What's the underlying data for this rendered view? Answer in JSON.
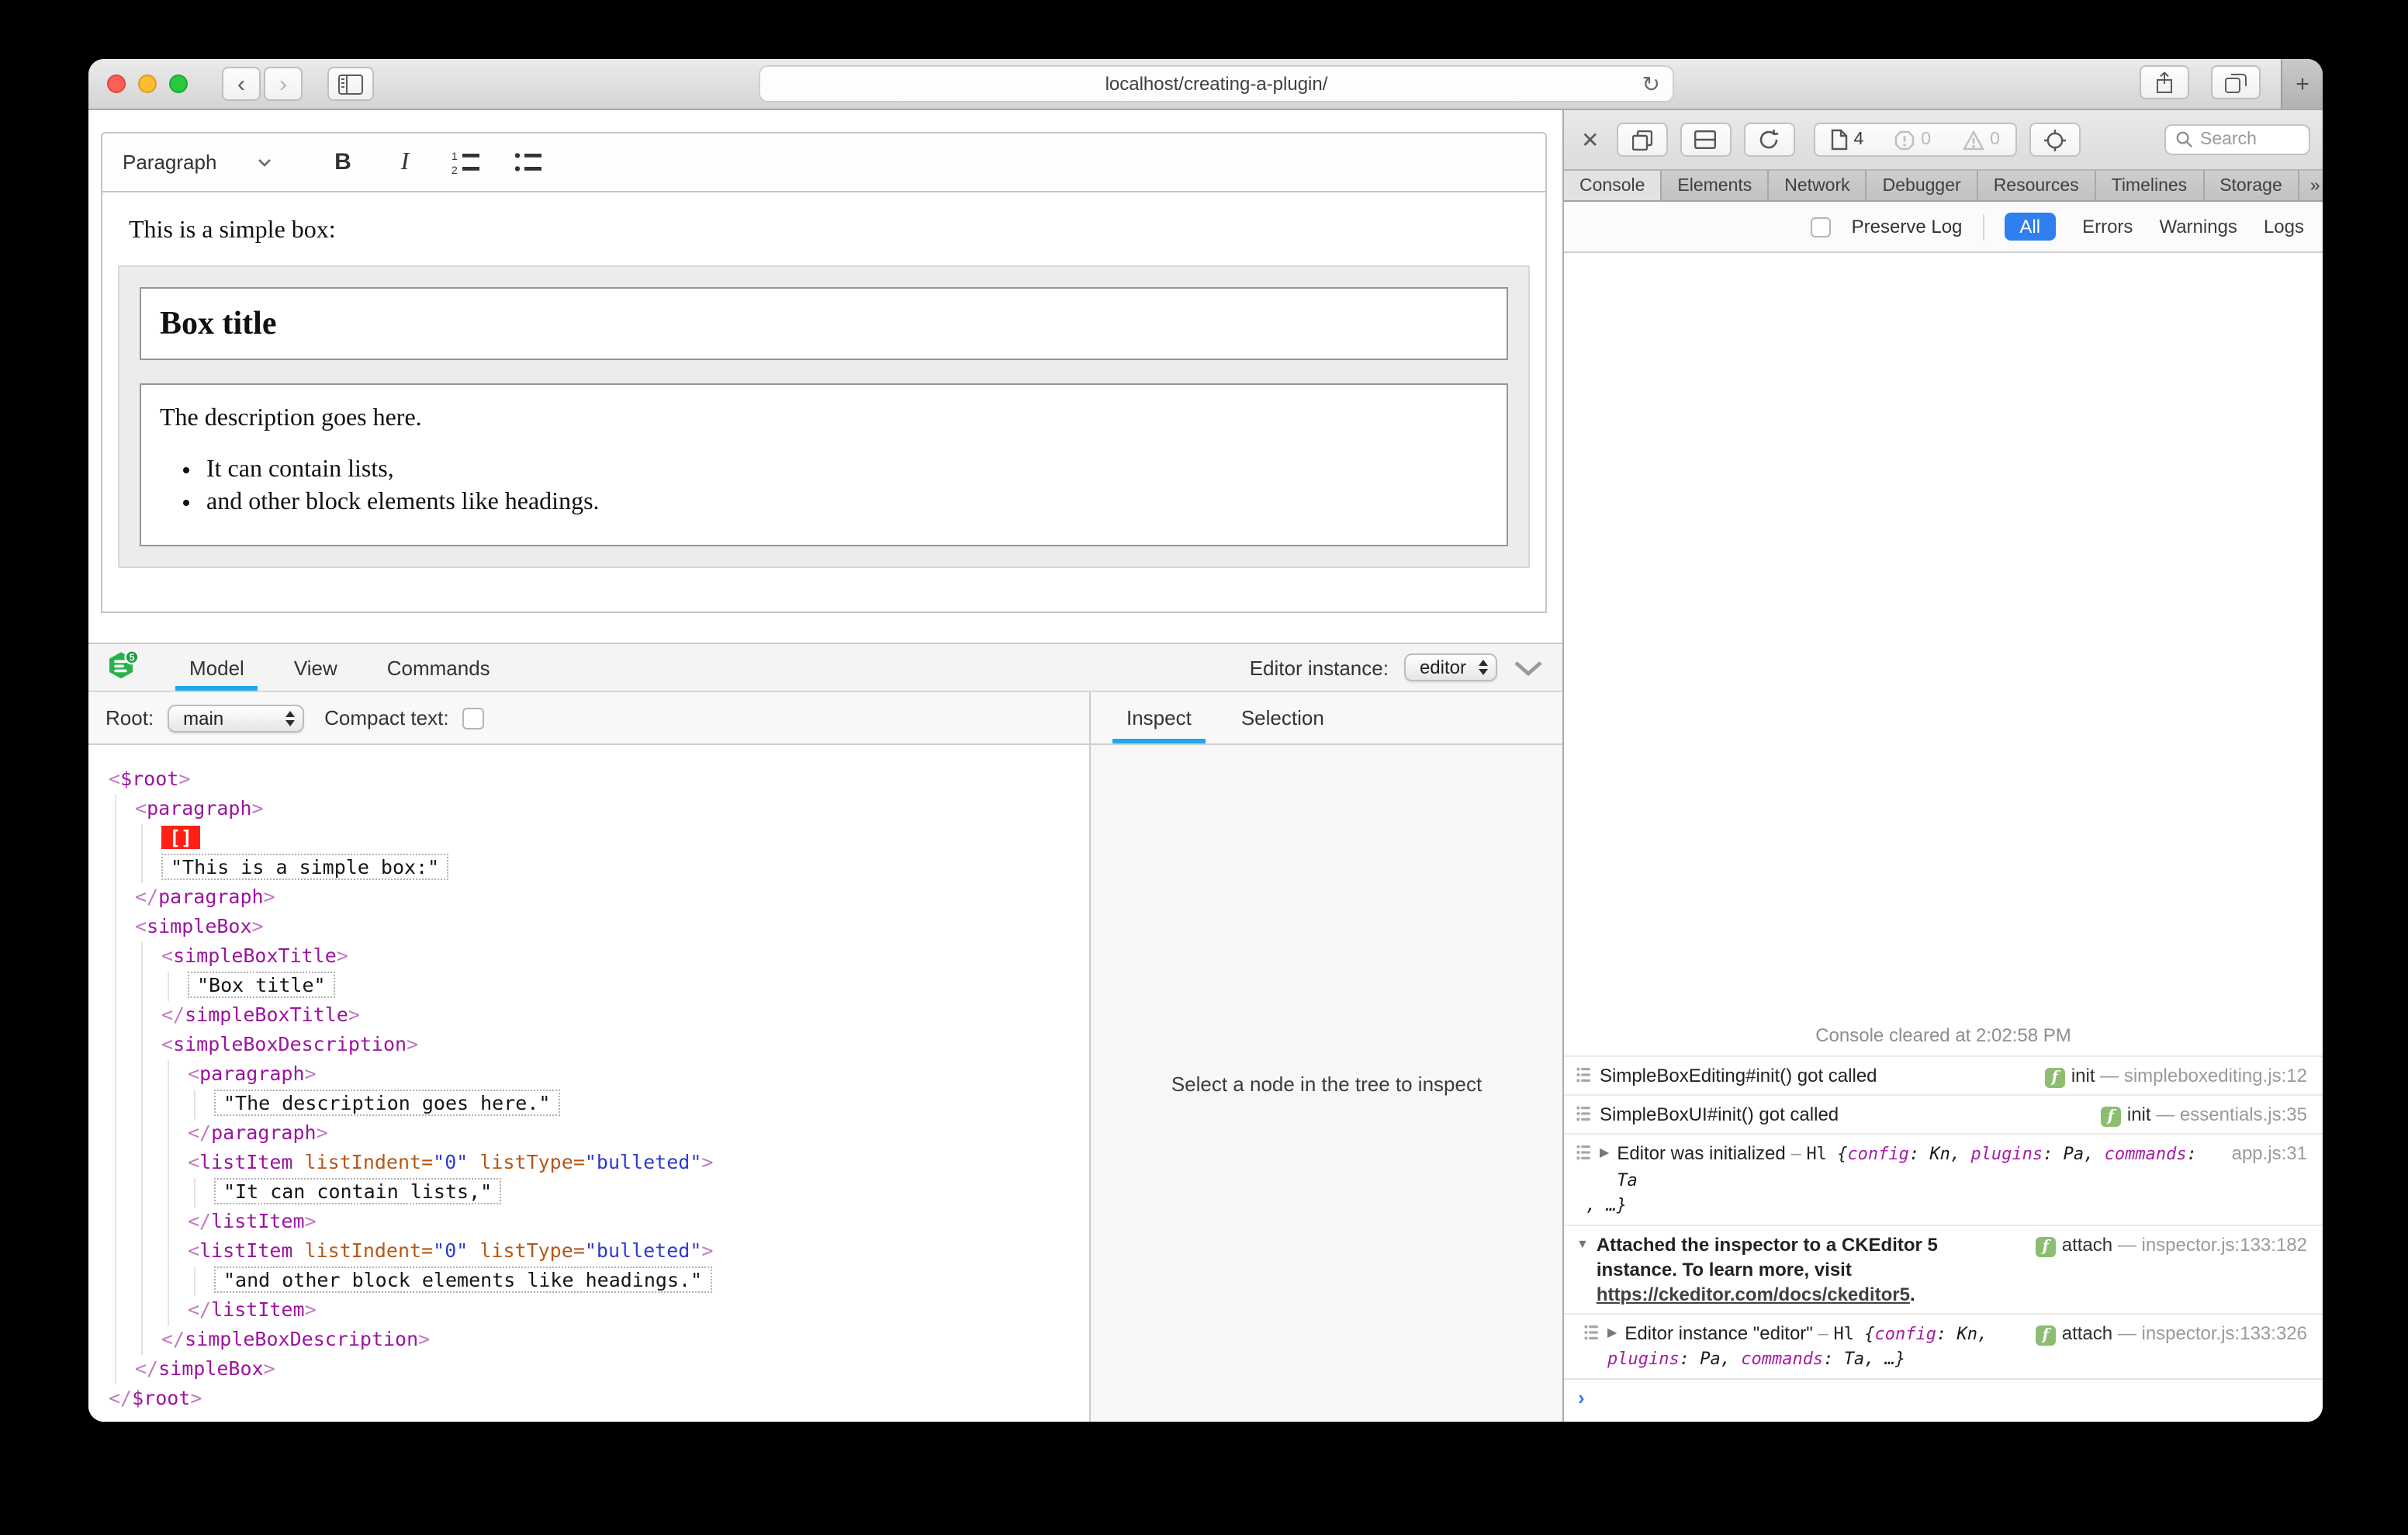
{
  "browser": {
    "url": "localhost/creating-a-plugin/",
    "icons": {
      "back": "‹",
      "forward": "›",
      "reload": "↻",
      "new_tab": "+",
      "close": "✕",
      "more_tabs": "»",
      "settings": "⚙",
      "prompt": "›"
    }
  },
  "editor": {
    "toolbar": {
      "paragraph_label": "Paragraph",
      "bold_label": "B",
      "italic_label": "I"
    },
    "content": {
      "intro": "This is a simple box:",
      "box_title": "Box title",
      "description": "The description goes here.",
      "list": [
        "It can contain lists,",
        "and other block elements like headings."
      ]
    }
  },
  "inspector": {
    "logo_badge": "5",
    "tabs": [
      "Model",
      "View",
      "Commands"
    ],
    "active_tab": "Model",
    "editor_instance_label": "Editor instance:",
    "editor_instance_value": "editor",
    "root_label": "Root:",
    "root_value": "main",
    "compact_text_label": "Compact text:",
    "side_tabs": [
      "Inspect",
      "Selection"
    ],
    "active_side_tab": "Inspect",
    "inspect_placeholder": "Select a node in the tree to inspect",
    "tree": [
      {
        "tag": "$root",
        "children": [
          {
            "tag": "paragraph",
            "children": [
              {
                "selection": "[]"
              },
              {
                "text": "\"This is a simple box:\""
              }
            ]
          },
          {
            "tag": "simpleBox",
            "children": [
              {
                "tag": "simpleBoxTitle",
                "children": [
                  {
                    "text": "\"Box title\""
                  }
                ]
              },
              {
                "tag": "simpleBoxDescription",
                "children": [
                  {
                    "tag": "paragraph",
                    "children": [
                      {
                        "text": "\"The description goes here.\""
                      }
                    ]
                  },
                  {
                    "tag": "listItem",
                    "attrs": [
                      [
                        "listIndent",
                        "\"0\""
                      ],
                      [
                        "listType",
                        "\"bulleted\""
                      ]
                    ],
                    "children": [
                      {
                        "text": "\"It can contain lists,\""
                      }
                    ]
                  },
                  {
                    "tag": "listItem",
                    "attrs": [
                      [
                        "listIndent",
                        "\"0\""
                      ],
                      [
                        "listType",
                        "\"bulleted\""
                      ]
                    ],
                    "children": [
                      {
                        "text": "\"and other block elements like headings.\""
                      }
                    ]
                  }
                ]
              }
            ]
          }
        ]
      }
    ]
  },
  "devtools": {
    "toolbar": {
      "page_count": "4",
      "error_count": "0",
      "warning_count": "0",
      "search_placeholder": "Search"
    },
    "tabs": [
      "Console",
      "Elements",
      "Network",
      "Debugger",
      "Resources",
      "Timelines",
      "Storage"
    ],
    "active_tab": "Console",
    "filter": {
      "preserve_log": "Preserve Log",
      "scopes": [
        "All",
        "Errors",
        "Warnings",
        "Logs"
      ],
      "active_scope": "All"
    },
    "console": {
      "cleared": "Console cleared at 2:02:58 PM",
      "entries": [
        {
          "gutter": true,
          "text": "SimpleBoxEditing#init() got called",
          "right": {
            "badge": "f",
            "fn": "init",
            "loc": "simpleboxediting.js:12"
          }
        },
        {
          "gutter": true,
          "text": "SimpleBoxUI#init() got called",
          "right": {
            "badge": "f",
            "fn": "init",
            "loc": "essentials.js:35"
          }
        },
        {
          "gutter": true,
          "arrow": "right",
          "text": "Editor was initialized",
          "obj": {
            "head": "Hl {",
            "pairs": [
              [
                "config",
                "Kn"
              ],
              [
                "plugins",
                "Pa"
              ],
              [
                "commands",
                "Ta"
              ]
            ],
            "line2_pairs": [],
            "line2_tail": ", …}"
          },
          "right": {
            "loc": "app.js:31"
          }
        },
        {
          "arrow": "down",
          "bold": true,
          "text": "Attached the inspector to a CKEditor 5 instance. To learn more, visit",
          "link": {
            "text": "https://ckeditor.com/docs/ckeditor5",
            "after": "."
          },
          "right": {
            "badge": "f",
            "fn": "attach",
            "loc": "inspector.js:133:182"
          }
        },
        {
          "gutter": true,
          "indent": true,
          "arrow": "right",
          "text": "Editor instance \"editor\"",
          "obj": {
            "head": "Hl {",
            "pairs": [
              [
                "config",
                "Kn"
              ]
            ],
            "line1_trail": ",",
            "line2_pairs": [
              [
                "plugins",
                "Pa"
              ],
              [
                "commands",
                "Ta"
              ]
            ],
            "line2_tail": ", …}"
          },
          "right": {
            "badge": "f",
            "fn": "attach",
            "loc": "inspector.js:133:326"
          }
        }
      ]
    }
  },
  "colors": {
    "accent_blue": "#1ea7ec",
    "safari_blue": "#2e7ff0",
    "badge_green": "#8cbe72",
    "logo_green": "#2ab14c",
    "tag_purple": "#9c14a0",
    "attr_orange": "#b5581a",
    "attr_value_blue": "#2d3bd0",
    "selection_red": "#ff2015"
  }
}
